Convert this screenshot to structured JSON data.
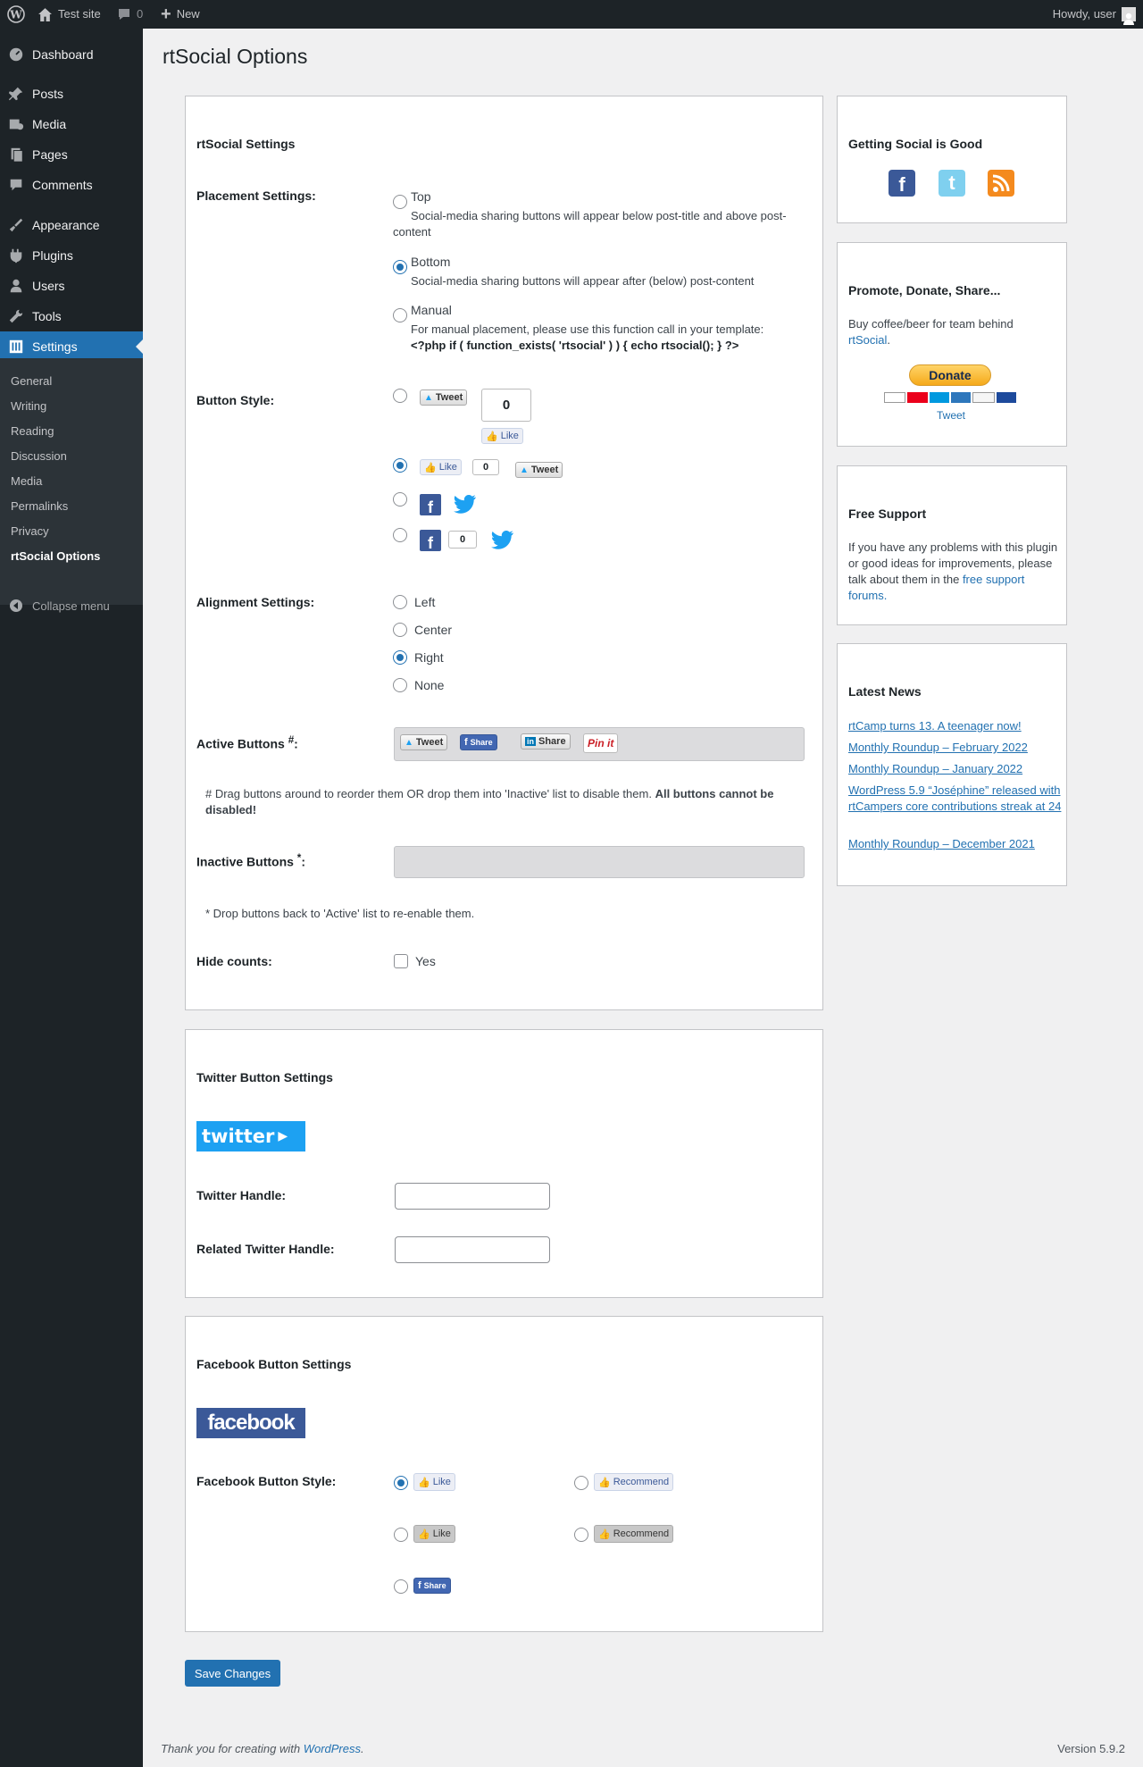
{
  "adminbar": {
    "site": "Test site",
    "comments": "0",
    "new": "New",
    "howdy": "Howdy, user"
  },
  "sidebar": {
    "items": [
      {
        "label": "Dashboard",
        "icon": "dashboard-icon"
      },
      {
        "label": "Posts",
        "icon": "pin-icon"
      },
      {
        "label": "Media",
        "icon": "media-icon"
      },
      {
        "label": "Pages",
        "icon": "pages-icon"
      },
      {
        "label": "Comments",
        "icon": "comment-icon"
      },
      {
        "label": "Appearance",
        "icon": "brush-icon"
      },
      {
        "label": "Plugins",
        "icon": "plug-icon"
      },
      {
        "label": "Users",
        "icon": "user-icon"
      },
      {
        "label": "Tools",
        "icon": "wrench-icon"
      },
      {
        "label": "Settings",
        "icon": "settings-icon"
      }
    ],
    "submenu": [
      "General",
      "Writing",
      "Reading",
      "Discussion",
      "Media",
      "Permalinks",
      "Privacy",
      "rtSocial Options"
    ],
    "collapse": "Collapse menu"
  },
  "page": {
    "title": "rtSocial Options"
  },
  "settings": {
    "heading": "rtSocial Settings",
    "placement": {
      "label": "Placement Settings:",
      "top": "Top",
      "top_desc": "Social-media sharing buttons will appear below post-title and above post-content",
      "bottom": "Bottom",
      "bottom_desc": "Social-media sharing buttons will appear after (below) post-content",
      "manual": "Manual",
      "manual_desc": "For manual placement, please use this function call in your template:",
      "manual_code": "<?php if ( function_exists( 'rtsocial' ) ) { echo rtsocial(); } ?>"
    },
    "button_style": {
      "label": "Button Style:",
      "tweet": "Tweet",
      "like": "Like",
      "zero": "0",
      "big_zero": "0"
    },
    "alignment": {
      "label": "Alignment Settings:",
      "left": "Left",
      "center": "Center",
      "right": "Right",
      "none": "None"
    },
    "active": {
      "label": "Active Buttons",
      "sup": "#",
      "colon": ":",
      "tweet": "Tweet",
      "share": "Share",
      "in_share": "Share",
      "pin": "Pin it"
    },
    "active_note": "# Drag buttons around to reorder them OR drop them into 'Inactive' list to disable them.",
    "active_note_bold": "All buttons cannot be disabled!",
    "inactive": {
      "label": "Inactive Buttons",
      "sup": "*",
      "colon": ":"
    },
    "inactive_note": "* Drop buttons back to 'Active' list to re-enable them.",
    "hide_counts": {
      "label": "Hide counts:",
      "yes": "Yes"
    }
  },
  "twitter": {
    "heading": "Twitter Button Settings",
    "logo": "twitter",
    "handle": "Twitter Handle:",
    "related": "Related Twitter Handle:"
  },
  "facebook": {
    "heading": "Facebook Button Settings",
    "logo": "facebook",
    "style_label": "Facebook Button Style:",
    "like": "Like",
    "recommend": "Recommend",
    "share": "Share"
  },
  "save": "Save Changes",
  "side": {
    "social": {
      "heading": "Getting Social is Good"
    },
    "donate": {
      "heading": "Promote, Donate, Share...",
      "text": "Buy coffee/beer for team behind",
      "link": "rtSocial",
      "period": ".",
      "button": "Donate",
      "tweet": "Tweet"
    },
    "support": {
      "heading": "Free Support",
      "text": "If you have any problems with this plugin or good ideas for improvements, please talk about them in the",
      "link": "free support forums."
    },
    "news": {
      "heading": "Latest News",
      "items": [
        "rtCamp turns 13. A teenager now!",
        "Monthly Roundup – February 2022",
        "Monthly Roundup – January 2022",
        "WordPress 5.9 “Joséphine” released with rtCampers core contributions streak at 24",
        "Monthly Roundup – December 2021"
      ]
    }
  },
  "footer": {
    "thanks": "Thank you for creating with",
    "link": "WordPress",
    "period": ".",
    "version": "Version 5.9.2"
  }
}
